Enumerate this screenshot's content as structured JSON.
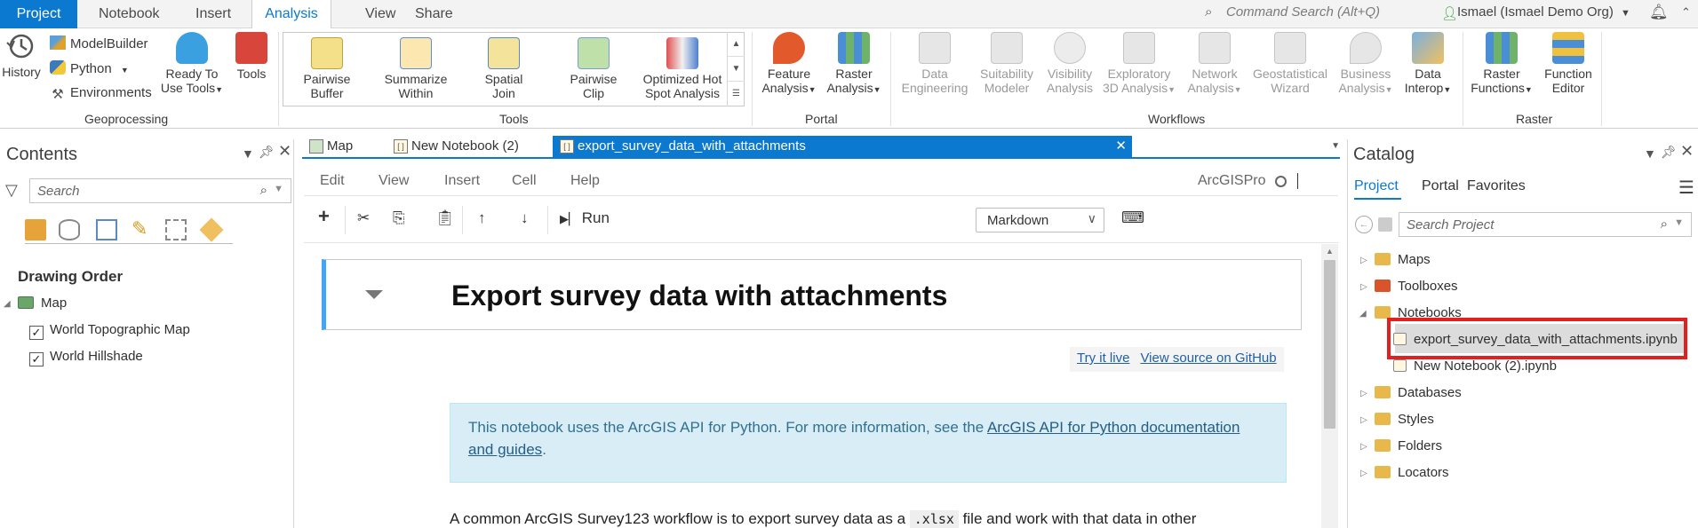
{
  "top_tabs": [
    "Project",
    "Notebook",
    "Insert",
    "Analysis",
    "View",
    "Share"
  ],
  "command_search": "Command Search (Alt+Q)",
  "user": "Ismael (Ismael Demo Org)",
  "ribbon": {
    "geoprocessing": {
      "label": "Geoprocessing",
      "history": "History",
      "modelbuilder": "ModelBuilder",
      "python": "Python",
      "environments": "Environments",
      "ready_to_use_1": "Ready To",
      "ready_to_use_2": "Use Tools",
      "tools": "Tools"
    },
    "tools": {
      "label": "Tools",
      "items": [
        {
          "l1": "Pairwise",
          "l2": "Buffer"
        },
        {
          "l1": "Summarize",
          "l2": "Within"
        },
        {
          "l1": "Spatial",
          "l2": "Join"
        },
        {
          "l1": "Pairwise",
          "l2": "Clip"
        },
        {
          "l1": "Optimized Hot",
          "l2": "Spot Analysis"
        }
      ]
    },
    "portal": {
      "label": "Portal",
      "feature_1": "Feature",
      "feature_2": "Analysis",
      "raster_1": "Raster",
      "raster_2": "Analysis"
    },
    "workflows": {
      "label": "Workflows",
      "items": [
        {
          "l1": "Data",
          "l2": "Engineering"
        },
        {
          "l1": "Suitability",
          "l2": "Modeler"
        },
        {
          "l1": "Visibility",
          "l2": "Analysis"
        },
        {
          "l1": "Exploratory",
          "l2": "3D Analysis"
        },
        {
          "l1": "Network",
          "l2": "Analysis"
        },
        {
          "l1": "Geostatistical",
          "l2": "Wizard"
        },
        {
          "l1": "Business",
          "l2": "Analysis"
        },
        {
          "l1": "Data",
          "l2": "Interop"
        }
      ]
    },
    "raster": {
      "label": "Raster",
      "rf_1": "Raster",
      "rf_2": "Functions",
      "fe_1": "Function",
      "fe_2": "Editor"
    }
  },
  "contents": {
    "title": "Contents",
    "search_placeholder": "Search",
    "drawing_order": "Drawing Order",
    "map": "Map",
    "layers": [
      "World Topographic Map",
      "World Hillshade"
    ]
  },
  "doc_tabs": [
    "Map",
    "New Notebook (2)",
    "export_survey_data_with_attachments"
  ],
  "notebook": {
    "menu": [
      "Edit",
      "View",
      "Insert",
      "Cell",
      "Help"
    ],
    "kernel": "ArcGISPro",
    "run": "Run",
    "cell_type": "Markdown",
    "title": "Export survey data with attachments",
    "link_try": "Try it live",
    "link_source": "View source on GitHub",
    "info_text": "This notebook uses the ArcGIS API for Python. For more information, see the ",
    "info_link_1": "ArcGIS API for Python documentation",
    "info_link_2": "and guides",
    "info_end": ".",
    "para_start": "A common ArcGIS Survey123 workflow is to export survey data as a ",
    "para_code": ".xlsx",
    "para_end": " file and work with that data in other"
  },
  "catalog": {
    "title": "Catalog",
    "tabs": [
      "Project",
      "Portal",
      "Favorites"
    ],
    "search_placeholder": "Search Project",
    "items": [
      "Maps",
      "Toolboxes",
      "Notebooks",
      "export_survey_data_with_attachments.ipynb",
      "New Notebook (2).ipynb",
      "Databases",
      "Styles",
      "Folders",
      "Locators"
    ]
  },
  "colors": {
    "accent": "#0b79d0",
    "highlight": "#e32020",
    "info_bg": "#d9edf7"
  }
}
